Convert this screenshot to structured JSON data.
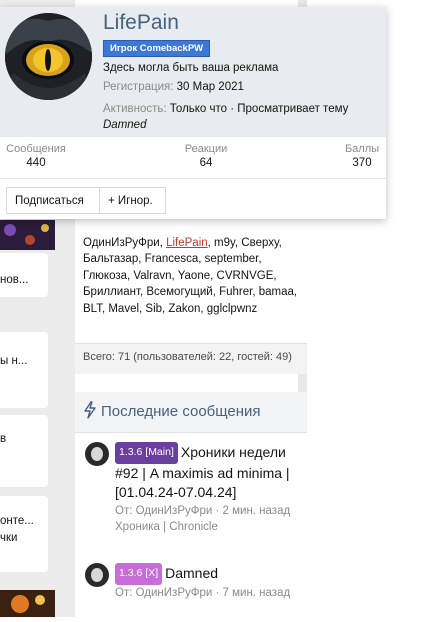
{
  "member_card": {
    "username": "LifePain",
    "banner": "Игрок ComebackPW",
    "tagline": "Здесь могла быть ваша реклама",
    "registration_label": "Регистрация:",
    "registration_date": "30 Мар 2021",
    "activity_label": "Активность:",
    "activity_value": "Только что · Просматривает тему",
    "activity_thread": "Damned",
    "stats": [
      {
        "label": "Сообщения",
        "value": "440"
      },
      {
        "label": "Реакции",
        "value": "64"
      },
      {
        "label": "Баллы",
        "value": "370"
      }
    ],
    "follow_label": "Подписаться",
    "ignore_label": "+ Игнор."
  },
  "left_column": {
    "snippets": [
      "нов...",
      "ы н...",
      "в",
      "онте...",
      "чки"
    ]
  },
  "online": {
    "list_before": "ОдинИзРуФри, ",
    "highlight": "LifePain",
    "list_after": ", m9y, Сверху, Бальтазар, Francesca, september, Глюкоза, Valravn, Yaone, CVRNVGE, Бриллиант, Всемогущий, Fuhrer, bamaa, BLT, Mavel, Sib, Zakon, gglclpwnz",
    "total": "Всего: 71 (пользователей: 22, гостей: 49)"
  },
  "latest": {
    "title": "Последние сообщения",
    "posts": [
      {
        "prefix": "1.3.6 [Main]",
        "prefix_color": "#6b3fa0",
        "title": "Хроники недели #92 | A maximis ad minima | [01.04.24-07.04.24]",
        "meta": "От: ОдинИзРуФри · 2 мин. назад",
        "forum": "Хроника | Chronicle"
      },
      {
        "prefix": "1.3.6 [X]",
        "prefix_color": "#c86dd7",
        "title": "Damned",
        "meta": "От: ОдинИзРуФри · 7 мин. назад",
        "forum": ""
      }
    ]
  },
  "colors": {
    "accent": "#47617e",
    "banner": "#3c78d8",
    "highlight": "#c0392b"
  }
}
